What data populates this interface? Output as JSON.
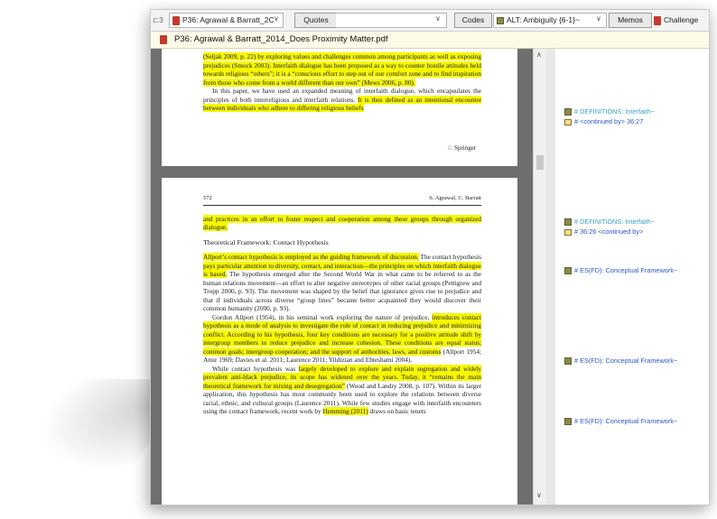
{
  "toolbar": {
    "doc_selector": "P36: Agrawal & Barratt_2C",
    "quotes_label": "Quotes",
    "codes_label": "Codes",
    "code_selector": "ALT: Ambiguity {6-1}~",
    "memos_label": "Memos",
    "challenge_label": "Challenge"
  },
  "document": {
    "title": "P36: Agrawal & Barratt_2014_Does Proximity Matter.pdf"
  },
  "page1": {
    "para1_a": "(Seljak 2009, p. 22) by exploring values and challenges common among participants as well as exposing prejudices (Smock 2003). Interfaith dialogue has been proposed as a way to counter hostile attitudes held towards religious “others”; it is a “conscious effort to step out of our comfort zone and to find inspiration from those who come from a world different than our own” (Mews 2006, p. 80).",
    "para2_a": "In this paper, we have used an expanded meaning of interfaith dialogue, which encapsulates the principles of both interreligious and interfaith relations. ",
    "para2_b": "It is thus defined as an intentional encounter between individuals who adhere to differing religious beliefs",
    "publisher": "Springer"
  },
  "page2": {
    "page_number": "572",
    "running_head": "S. Agrawal, C. Barratt",
    "intro_hl": "and practices in an effort to foster respect and cooperation among these groups through organized dialogue.",
    "section_title": "Theoretical Framework: Contact Hypothesis",
    "p1_hl1": "Allport’s contact hypothesis is employed as the guiding framework of discussion.",
    "p1_t1": " The contact hypothesis ",
    "p1_hl2": "pays particular attention to diversity, contact, and interaction—the principles on which interfaith dialogue is based.",
    "p1_t2": " The hypothesis emerged after the Second World War in what came to be referred to as the human relations movement—an effort to alter negative stereotypes of other racial groups (Pettigrew and Tropp 2000, p. 93). The movement was shaped by the belief that ignorance gives rise to prejudice and that if individuals across diverse “group lines” became better acquainted they would discover their common humanity (2000, p. 93).",
    "p2_t1": "Gordon Allport (1954), in his seminal work exploring the nature of prejudice, ",
    "p2_hl": "introduces contact hypothesis as a mode of analysis to investigate the role of contact in reducing prejudice and minimizing conflict. According to his hypothesis, four key conditions are necessary for a positive attitude shift by intergroup members to reduce prejudice and increase cohesion. These conditions are equal status; common goals; intergroup cooperation; and the support of authorities, laws, and customs",
    "p2_t2": " (Allport 1954; Amir 1969; Davies et al. 2011; Laurence 2011; Yildizian and Ehteshami 2004).",
    "p3_t1": "While contact hypothesis was ",
    "p3_hl": "largely developed to explore and explain segregation and widely prevalent anti-black prejudice, its scope has widened over the years. Today, it “remains the main theoretical framework for mixing and desegregation”",
    "p3_t2": " (Wood and Landry 2008, p. 107). Within its larger application, this hypothesis has most commonly been used to explore the relations between diverse racial, ethnic, and cultural groups (Laurence 2011). While few studies engage with interfaith encounters using the contact framework, recent work by ",
    "p3_hl2": "Hemming (2011)",
    "p3_t3": " draws on basic tenets"
  },
  "margin": {
    "code1": "# DEFINITIONS: Interfaith~",
    "memo1": "# <continued by> 36:27",
    "code2": "# DEFINITIONS: Interfaith~",
    "memo2": "# 36:26 <continued by>",
    "code3": "# ES(FD): Conceptual Framework~",
    "code4": "# ES(FD): Conceptual Framework~",
    "code5": "# ES(FD): Conceptual Framework~"
  }
}
